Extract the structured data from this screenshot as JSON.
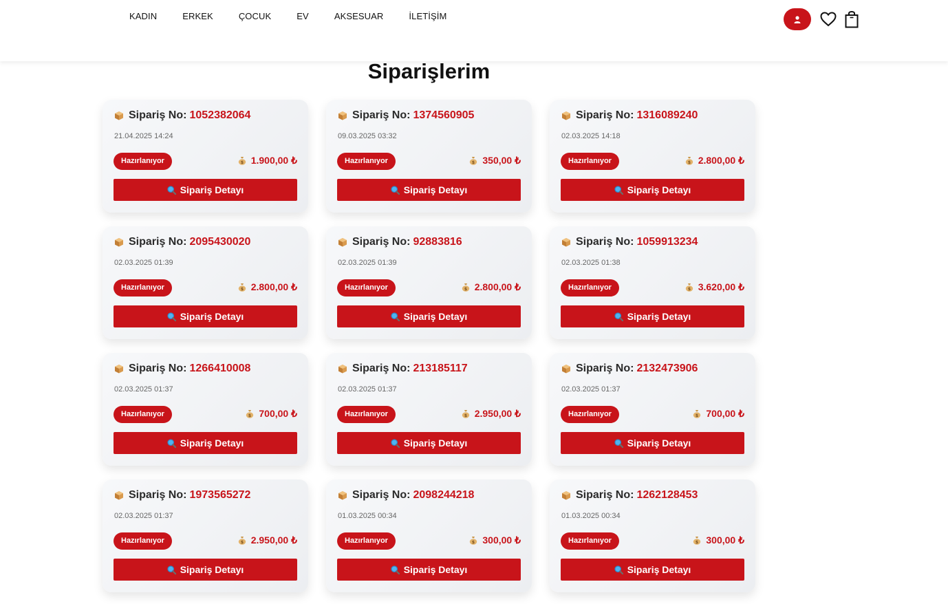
{
  "nav": {
    "items": [
      "KADIN",
      "ERKEK",
      "ÇOCUK",
      "EV",
      "AKSESUAR",
      "İLETİŞİM"
    ]
  },
  "header_icons": [
    "user-icon",
    "heart-icon",
    "shopping-bag-icon"
  ],
  "colors": {
    "brand_red": "#c8141a",
    "card_bg": "#f1f2f4"
  },
  "page_title": "Siparişlerim",
  "card_labels": {
    "order_label": "Sipariş No:",
    "detail_button": "Sipariş Detayı"
  },
  "orders": [
    {
      "no": "1052382064",
      "date": "21.04.2025 14:24",
      "status": "Hazırlanıyor",
      "price": "1.900,00 ₺"
    },
    {
      "no": "1374560905",
      "date": "09.03.2025 03:32",
      "status": "Hazırlanıyor",
      "price": "350,00 ₺"
    },
    {
      "no": "1316089240",
      "date": "02.03.2025 14:18",
      "status": "Hazırlanıyor",
      "price": "2.800,00 ₺"
    },
    {
      "no": "2095430020",
      "date": "02.03.2025 01:39",
      "status": "Hazırlanıyor",
      "price": "2.800,00 ₺"
    },
    {
      "no": "92883816",
      "date": "02.03.2025 01:39",
      "status": "Hazırlanıyor",
      "price": "2.800,00 ₺"
    },
    {
      "no": "1059913234",
      "date": "02.03.2025 01:38",
      "status": "Hazırlanıyor",
      "price": "3.620,00 ₺"
    },
    {
      "no": "1266410008",
      "date": "02.03.2025 01:37",
      "status": "Hazırlanıyor",
      "price": "700,00 ₺"
    },
    {
      "no": "213185117",
      "date": "02.03.2025 01:37",
      "status": "Hazırlanıyor",
      "price": "2.950,00 ₺"
    },
    {
      "no": "2132473906",
      "date": "02.03.2025 01:37",
      "status": "Hazırlanıyor",
      "price": "700,00 ₺"
    },
    {
      "no": "1973565272",
      "date": "02.03.2025 01:37",
      "status": "Hazırlanıyor",
      "price": "2.950,00 ₺"
    },
    {
      "no": "2098244218",
      "date": "01.03.2025 00:34",
      "status": "Hazırlanıyor",
      "price": "300,00 ₺"
    },
    {
      "no": "1262128453",
      "date": "01.03.2025 00:34",
      "status": "Hazırlanıyor",
      "price": "300,00 ₺"
    }
  ]
}
